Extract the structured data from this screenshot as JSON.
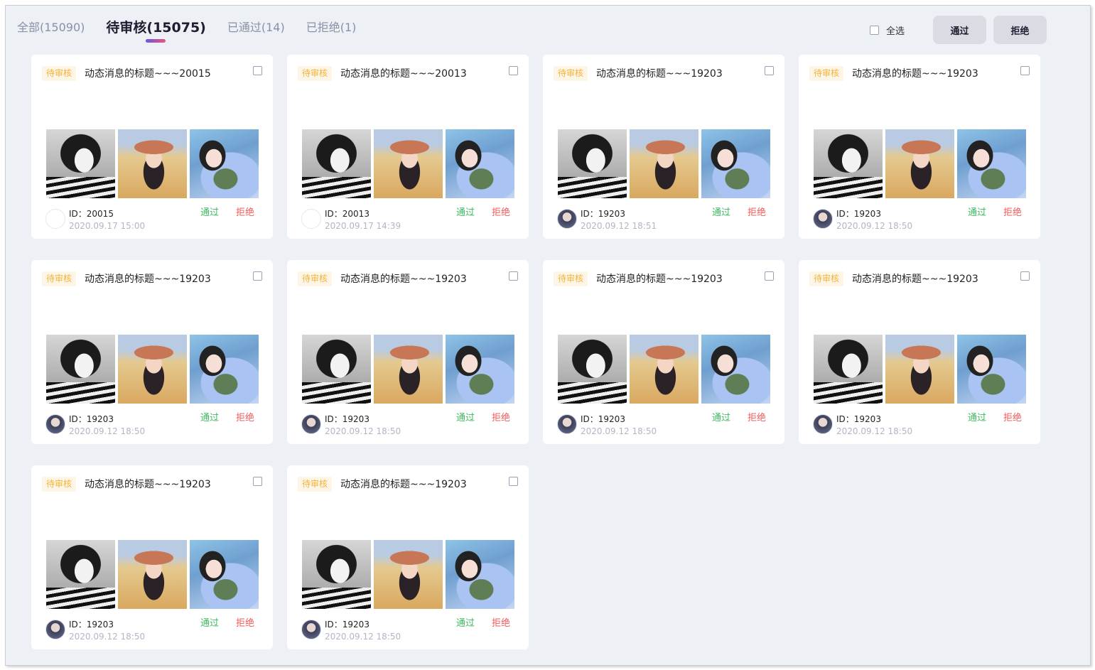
{
  "tabs": [
    {
      "label": "全部(15090)"
    },
    {
      "label": "待审核(15075)"
    },
    {
      "label": "已通过(14)"
    },
    {
      "label": "已拒绝(1)"
    }
  ],
  "actions": {
    "select_all_label": "全选",
    "pass_label": "通过",
    "reject_label": "拒绝"
  },
  "cards": [
    {
      "status": "待审核",
      "title": "动态消息的标题~~~20015",
      "user_id": "ID：20015",
      "time": "2020.09.17 15:00",
      "pass": "通过",
      "reject": "拒绝"
    },
    {
      "status": "待审核",
      "title": "动态消息的标题~~~20013",
      "user_id": "ID：20013",
      "time": "2020.09.17 14:39",
      "pass": "通过",
      "reject": "拒绝"
    },
    {
      "status": "待审核",
      "title": "动态消息的标题~~~19203",
      "user_id": "ID：19203",
      "time": "2020.09.12 18:51",
      "pass": "通过",
      "reject": "拒绝"
    },
    {
      "status": "待审核",
      "title": "动态消息的标题~~~19203",
      "user_id": "ID：19203",
      "time": "2020.09.12 18:50",
      "pass": "通过",
      "reject": "拒绝"
    },
    {
      "status": "待审核",
      "title": "动态消息的标题~~~19203",
      "user_id": "ID：19203",
      "time": "2020.09.12 18:50",
      "pass": "通过",
      "reject": "拒绝"
    },
    {
      "status": "待审核",
      "title": "动态消息的标题~~~19203",
      "user_id": "ID：19203",
      "time": "2020.09.12 18:50",
      "pass": "通过",
      "reject": "拒绝"
    },
    {
      "status": "待审核",
      "title": "动态消息的标题~~~19203",
      "user_id": "ID：19203",
      "time": "2020.09.12 18:50",
      "pass": "通过",
      "reject": "拒绝"
    },
    {
      "status": "待审核",
      "title": "动态消息的标题~~~19203",
      "user_id": "ID：19203",
      "time": "2020.09.12 18:50",
      "pass": "通过",
      "reject": "拒绝"
    },
    {
      "status": "待审核",
      "title": "动态消息的标题~~~19203",
      "user_id": "ID：19203",
      "time": "2020.09.12 18:50",
      "pass": "通过",
      "reject": "拒绝"
    },
    {
      "status": "待审核",
      "title": "动态消息的标题~~~19203",
      "user_id": "ID：19203",
      "time": "2020.09.12 18:50",
      "pass": "通过",
      "reject": "拒绝"
    }
  ],
  "colors": {
    "status_pending": "#f3b33c",
    "pass": "#3fb95f",
    "reject": "#ef5b5b",
    "accent_gradient_start": "#6d55e0",
    "accent_gradient_end": "#e8557b"
  }
}
